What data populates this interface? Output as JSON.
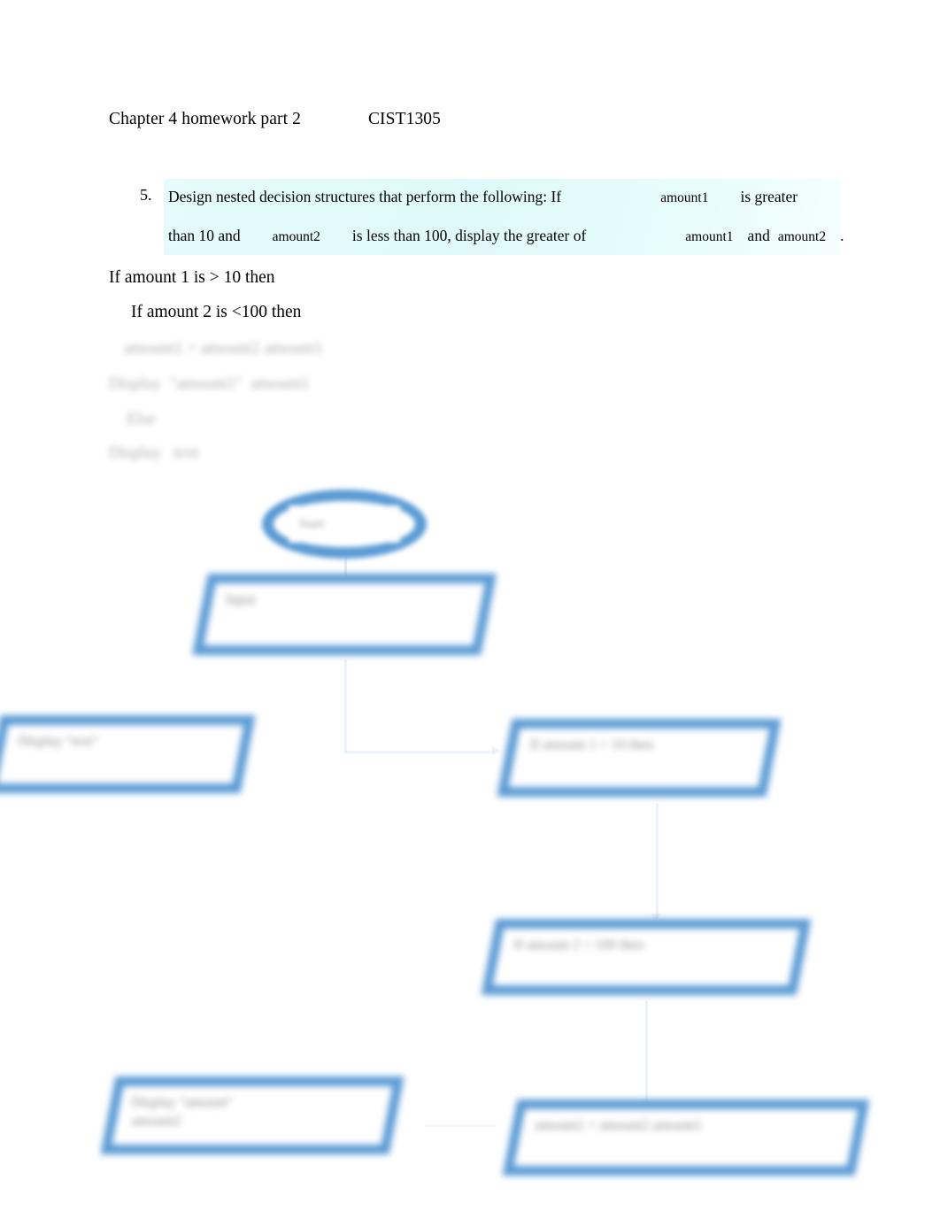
{
  "document": {
    "header": {
      "title": "Chapter 4 homework part 2",
      "course": "CIST1305"
    },
    "question": {
      "number": "5.",
      "line1_part1": "Design nested decision structures that perform the following: If",
      "line1_var1": "amount1",
      "line1_part2": "is greater",
      "line2_part1": "than 10 and",
      "line2_var1": "amount2",
      "line2_part2": "is less than 100, display the greater of",
      "line2_var2": "amount1",
      "line2_conj": "and",
      "line2_var3": "amount2",
      "line2_period": ".",
      "highlight_color": "#dffafa"
    },
    "pseudocode": {
      "visible": [
        "If amount 1 is > 10 then",
        "If amount 2 is <100 then"
      ],
      "blurred": [
        "amount1 > amount2 amount1",
        "Display  \"amount1\"  amount1",
        "Else",
        "Display   text"
      ]
    }
  },
  "flowchart": {
    "accent_color": "#5b9bd5",
    "connector_color": "#cfe0ef",
    "nodes": [
      {
        "id": "start",
        "shape": "oval",
        "label": "Start"
      },
      {
        "id": "input",
        "shape": "parallelogram",
        "label": "Input"
      },
      {
        "id": "display-text",
        "shape": "parallelogram",
        "label": "Display  \"text\""
      },
      {
        "id": "if-amount1",
        "shape": "parallelogram",
        "label": "If amount 1 > 10 then"
      },
      {
        "id": "if-amount2",
        "shape": "parallelogram",
        "label": "If amount 2 < 100 then"
      },
      {
        "id": "display-else",
        "shape": "parallelogram",
        "label": "Display  \"amount\"\namount2"
      },
      {
        "id": "display-max",
        "shape": "parallelogram",
        "label": "amount1 > amount2 amount1"
      }
    ],
    "connectors": [
      {
        "from": "start",
        "to": "input"
      },
      {
        "from": "input",
        "to": "if-amount1"
      },
      {
        "from": "if-amount1",
        "to": "if-amount2"
      },
      {
        "from": "if-amount2",
        "to": "display-max"
      },
      {
        "from": "display-max",
        "to": "display-else"
      }
    ]
  }
}
